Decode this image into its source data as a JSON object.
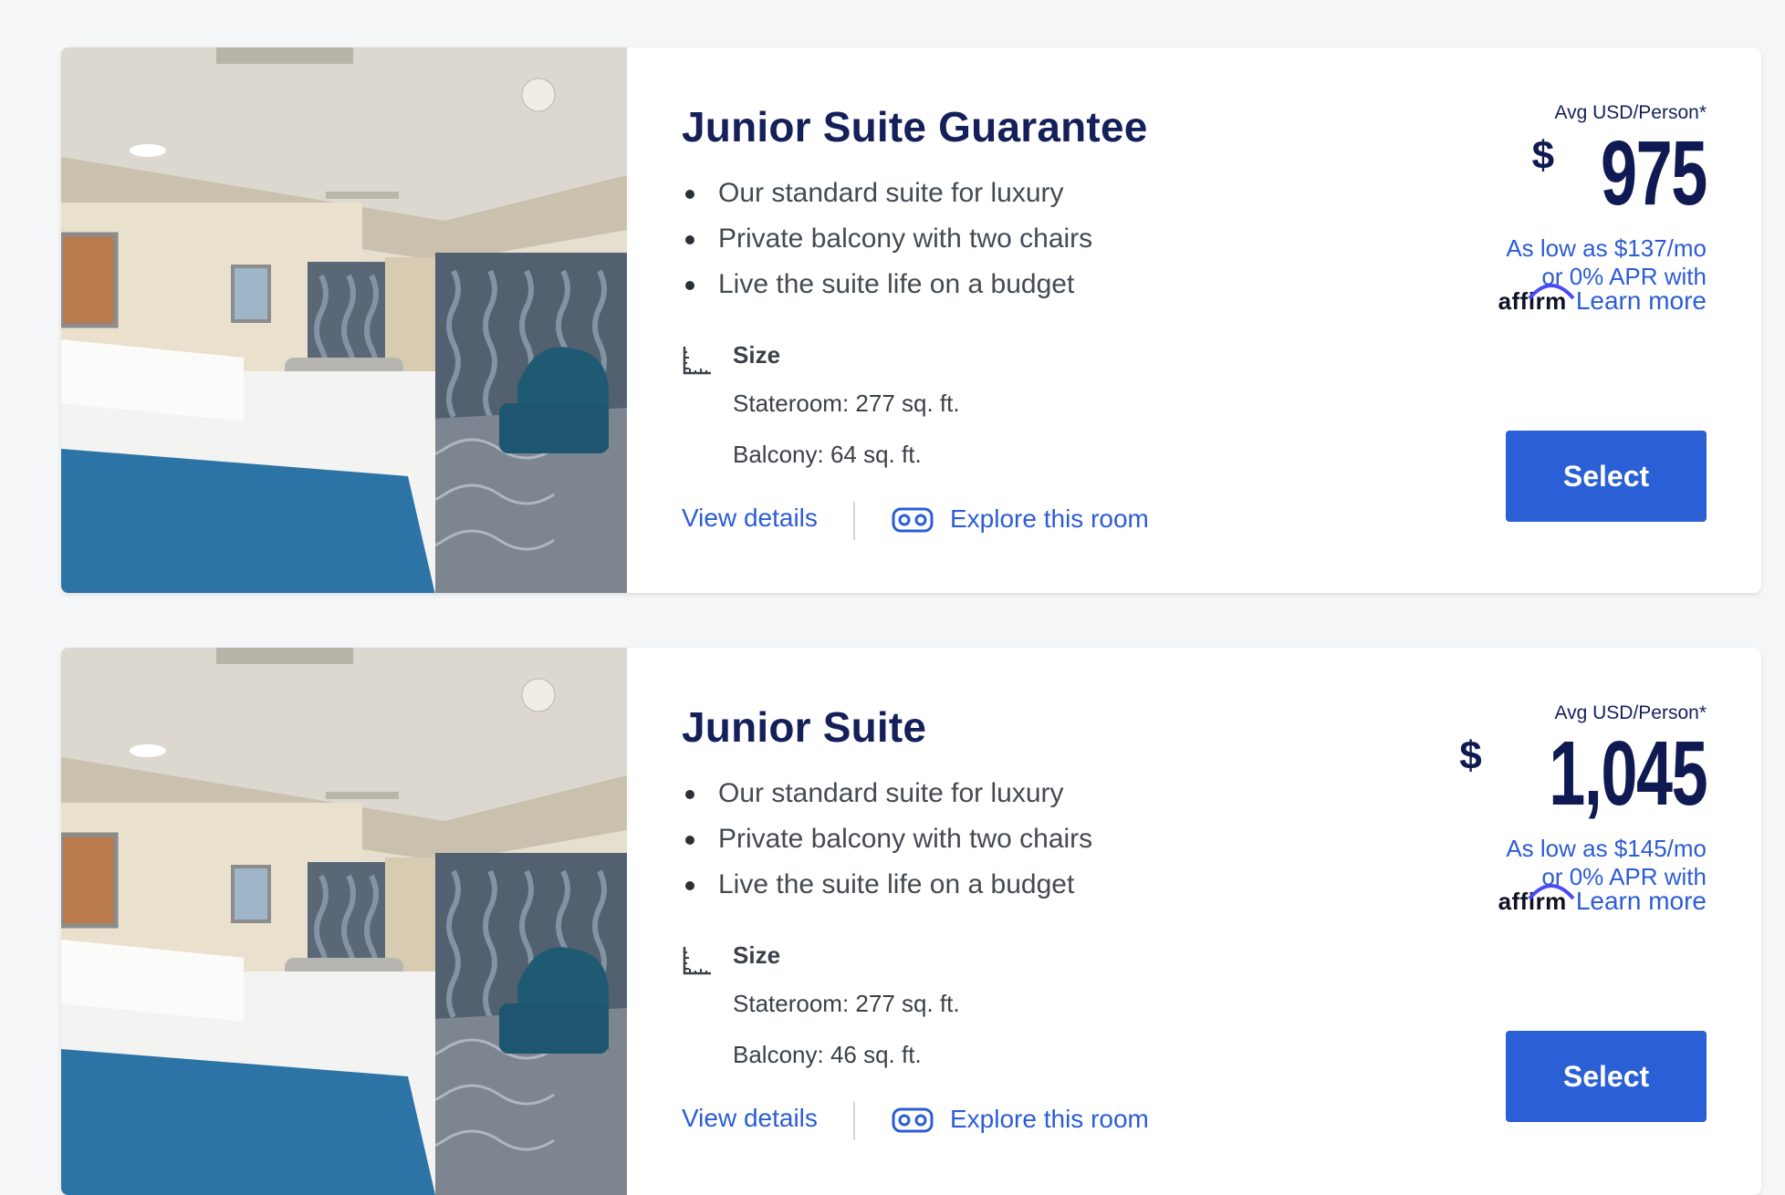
{
  "rooms": [
    {
      "title": "Junior Suite Guarantee",
      "features": [
        "Our standard suite for luxury",
        "Private balcony with two chairs",
        "Live the suite life on a budget"
      ],
      "size_label": "Size",
      "stateroom": "Stateroom: 277 sq. ft.",
      "balcony": "Balcony: 64 sq. ft.",
      "view_details": "View details",
      "explore": "Explore this room",
      "price_label": "Avg USD/Person*",
      "currency": "$",
      "price": "975",
      "low_as_line1": "As low as $137/mo",
      "low_as_line2": "or 0% APR with",
      "affirm": "affirm",
      "learn_more": "Learn more",
      "select": "Select"
    },
    {
      "title": "Junior Suite",
      "features": [
        "Our standard suite for luxury",
        "Private balcony with two chairs",
        "Live the suite life on a budget"
      ],
      "size_label": "Size",
      "stateroom": "Stateroom: 277 sq. ft.",
      "balcony": "Balcony: 46 sq. ft.",
      "view_details": "View details",
      "explore": "Explore this room",
      "price_label": "Avg USD/Person*",
      "currency": "$",
      "price": "1,045",
      "low_as_line1": "As low as $145/mo",
      "low_as_line2": "or 0% APR with",
      "affirm": "affirm",
      "learn_more": "Learn more",
      "select": "Select"
    }
  ],
  "colors": {
    "accent": "#2a5fd6",
    "title": "#15205a",
    "page_bg": "#f5f6f8"
  },
  "icons": [
    "ruler-icon",
    "vr-headset-icon",
    "affirm-logo"
  ]
}
